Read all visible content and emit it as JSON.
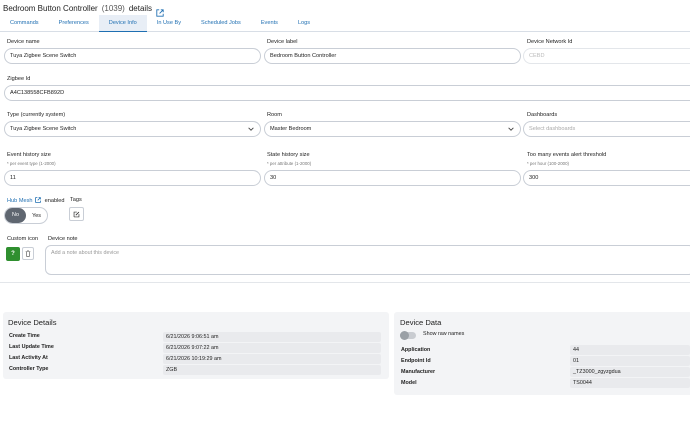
{
  "header": {
    "title": "Bedroom Button Controller",
    "device_id": "(1039)",
    "title_suffix": "details"
  },
  "tabs": [
    {
      "label": "Commands",
      "active": false
    },
    {
      "label": "Preferences",
      "active": false
    },
    {
      "label": "Device Info",
      "active": true
    },
    {
      "label": "In Use By",
      "active": false
    },
    {
      "label": "Scheduled Jobs",
      "active": false
    },
    {
      "label": "Events",
      "active": false
    },
    {
      "label": "Logs",
      "active": false
    }
  ],
  "form": {
    "device_name": {
      "label": "Device name",
      "value": "Tuya Zigbee Scene Switch"
    },
    "device_label": {
      "label": "Device label",
      "value": "Bedroom Button Controller"
    },
    "device_network_id": {
      "label": "Device Network Id",
      "value": "CEBD"
    },
    "zigbee_id": {
      "label": "Zigbee Id",
      "value": "A4C138558CFB892D"
    },
    "type": {
      "label": "Type (currently system)",
      "value": "Tuya Zigbee Scene Switch"
    },
    "room": {
      "label": "Room",
      "value": "Master Bedroom"
    },
    "dashboards": {
      "label": "Dashboards",
      "placeholder": "Select dashboards"
    },
    "event_history": {
      "label": "Event history size",
      "hint": "* per event type (1-2000)",
      "value": "11"
    },
    "state_history": {
      "label": "State history size",
      "hint": "* per attribute (1-2000)",
      "value": "30"
    },
    "too_many_events": {
      "label": "Too many events alert threshold",
      "hint": "* per hour (100-2000)",
      "value": "300"
    },
    "hub_mesh": {
      "label": "Hub Mesh",
      "suffix": "enabled",
      "no": "No",
      "yes": "Yes"
    },
    "tags": {
      "label": "Tags"
    },
    "custom_icon": {
      "label": "Custom icon",
      "button": "?"
    },
    "device_note": {
      "label": "Device note",
      "placeholder": "Add a note about this device"
    }
  },
  "device_details": {
    "title": "Device Details",
    "rows": [
      {
        "key": "Create Time",
        "value": "6/21/2026 9:06:51 am"
      },
      {
        "key": "Last Update Time",
        "value": "6/21/2026 9:07:22 am"
      },
      {
        "key": "Last Activity At",
        "value": "6/21/2026 10:19:29 am"
      },
      {
        "key": "Controller Type",
        "value": "ZGB"
      }
    ]
  },
  "device_data": {
    "title": "Device Data",
    "show_raw_names": "Show raw names",
    "rows": [
      {
        "key": "Application",
        "value": "44"
      },
      {
        "key": "Endpoint Id",
        "value": "01"
      },
      {
        "key": "Manufacturer",
        "value": "_TZ3000_zgyzgdua"
      },
      {
        "key": "Model",
        "value": "TS0044"
      }
    ]
  },
  "colors": {
    "link": "#1f6fb2",
    "toggle_selected": "#5f6670",
    "icon_button": "#2f8f2f"
  }
}
